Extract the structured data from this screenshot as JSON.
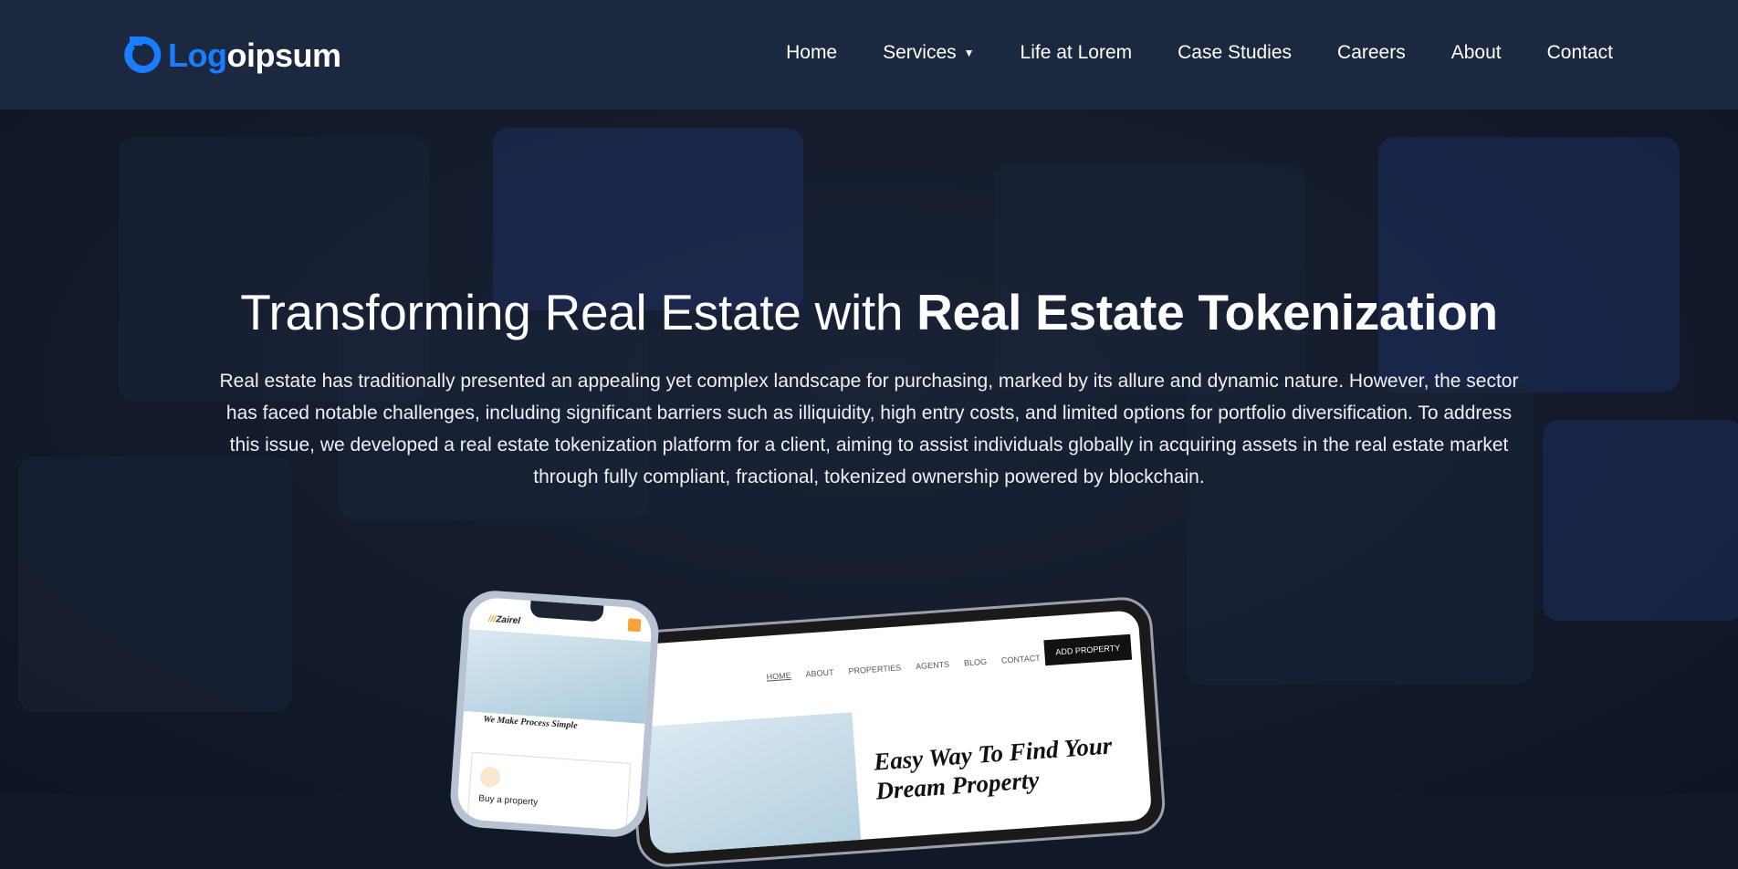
{
  "header": {
    "logo_left": "Log",
    "logo_right": "oipsum",
    "nav": [
      {
        "label": "Home"
      },
      {
        "label": "Services",
        "has_dropdown": true
      },
      {
        "label": "Life at Lorem"
      },
      {
        "label": "Case Studies"
      },
      {
        "label": "Careers"
      },
      {
        "label": "About"
      },
      {
        "label": "Contact"
      }
    ]
  },
  "hero": {
    "title_light": "Transforming Real Estate with ",
    "title_bold": "Real Estate Tokenization",
    "description": "Real estate has traditionally presented an appealing yet complex landscape for purchasing, marked by its allure and dynamic nature. However, the sector has faced notable challenges, including significant barriers such as illiquidity, high entry costs, and limited options for portfolio diversification. To address this issue, we developed a real estate tokenization platform for a client, aiming to assist individuals globally in acquiring assets in the real estate market through fully compliant, fractional, tokenized ownership powered by blockchain."
  },
  "mockup": {
    "phone_brand": "Zairel",
    "phone_heading": "We Make Process Simple",
    "phone_card": "Buy a property",
    "tablet_nav": [
      "HOME",
      "ABOUT",
      "PROPERTIES",
      "AGENTS",
      "BLOG",
      "CONTACT"
    ],
    "tablet_cta": "ADD PROPERTY",
    "tablet_heading_1": "Easy Way To Find Your",
    "tablet_heading_2": "Dream Property"
  },
  "colors": {
    "brand": "#1a7cff",
    "header_bg": "#1c2840",
    "accent_orange": "#f7a33a"
  }
}
